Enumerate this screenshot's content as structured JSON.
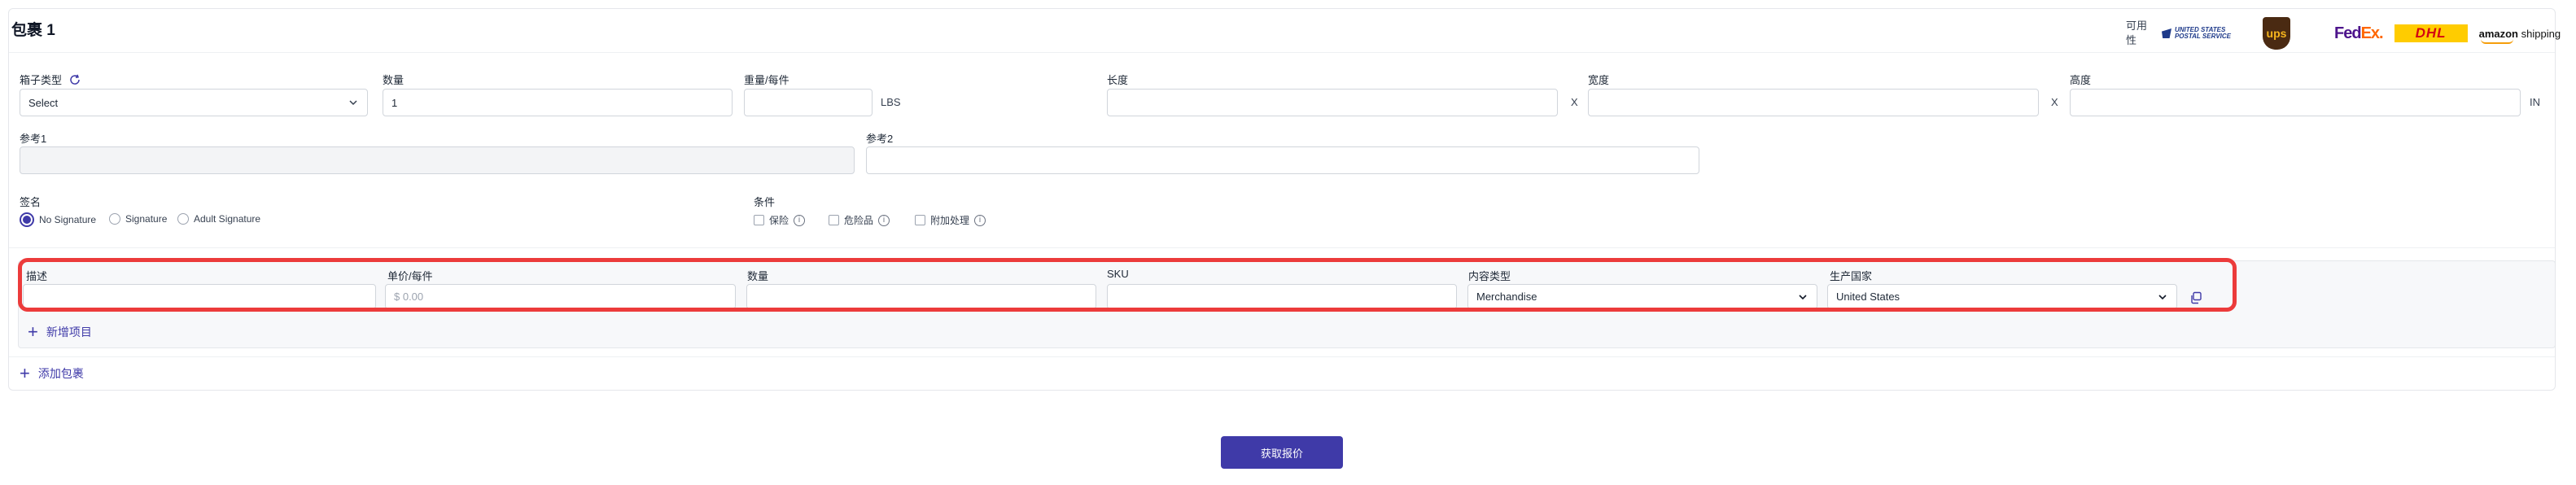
{
  "package": {
    "title": "包裹 1",
    "availability_label": "可用性",
    "carriers": {
      "usps": "UNITED STATES POSTAL SERVICE",
      "ups": "ups",
      "fedex_fed": "Fed",
      "fedex_ex": "Ex.",
      "dhl": "DHL",
      "amazon": "amazon",
      "amazon_suffix": "shipping"
    },
    "box_type": {
      "label": "箱子类型",
      "value": "Select"
    },
    "quantity": {
      "label": "数量",
      "value": "1"
    },
    "weight": {
      "label": "重量/每件",
      "value": "",
      "unit": "LBS"
    },
    "length": {
      "label": "长度",
      "value": ""
    },
    "width": {
      "label": "宽度",
      "value": ""
    },
    "height": {
      "label": "高度",
      "value": "",
      "unit": "IN"
    },
    "dim_separator": "X",
    "reference1": {
      "label": "参考1",
      "value": ""
    },
    "reference2": {
      "label": "参考2",
      "value": ""
    },
    "signature": {
      "label": "签名",
      "options": [
        "No Signature",
        "Signature",
        "Adult Signature"
      ],
      "selected": "No Signature"
    },
    "conditions": {
      "label": "条件",
      "options": [
        "保险",
        "危险品",
        "附加处理"
      ]
    },
    "item": {
      "description": {
        "label": "描述",
        "value": ""
      },
      "unit_price": {
        "label": "单价/每件",
        "placeholder": "$ 0.00"
      },
      "quantity": {
        "label": "数量",
        "value": ""
      },
      "sku": {
        "label": "SKU",
        "value": ""
      },
      "content_type": {
        "label": "内容类型",
        "value": "Merchandise"
      },
      "origin_country": {
        "label": "生产国家",
        "value": "United States"
      }
    },
    "add_item_label": "新增项目"
  },
  "add_package_label": "添加包裹",
  "get_quote_label": "获取报价",
  "colors": {
    "accent": "#3f3aa8",
    "highlight": "#ec3b3b"
  }
}
